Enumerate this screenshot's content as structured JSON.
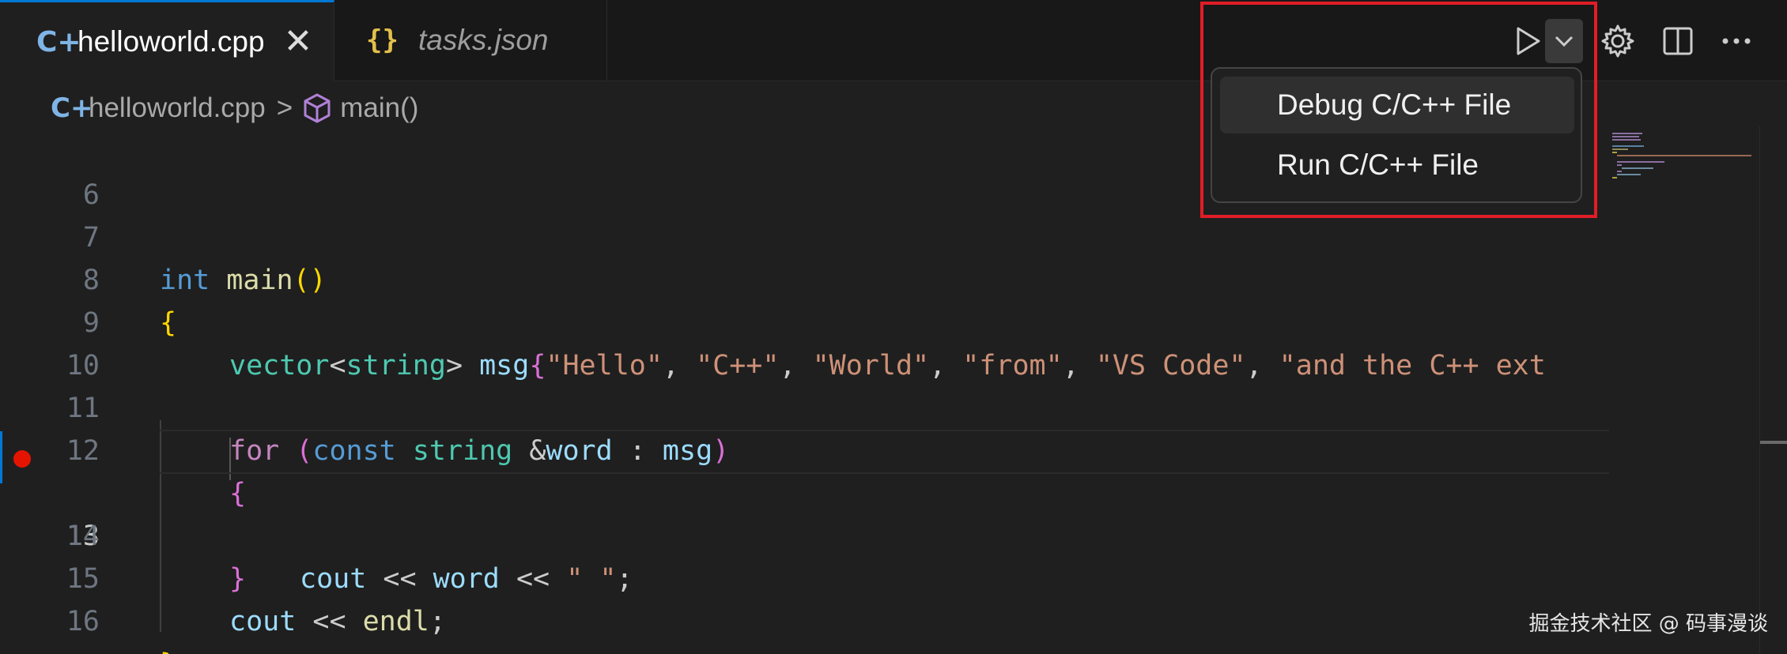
{
  "tabs": [
    {
      "icon": "C+",
      "label": "helloworld.cpp",
      "active": true,
      "close_glyph": "✕"
    },
    {
      "icon": "{}",
      "label": "tasks.json",
      "active": false
    }
  ],
  "breadcrumb": {
    "file_icon": "C+",
    "file": "helloworld.cpp",
    "separator": ">",
    "symbol": "main()"
  },
  "code": {
    "current_line": 13,
    "breakpoint_line": 13,
    "line_numbers": [
      "6",
      "7",
      "8",
      "9",
      "10",
      "11",
      "12",
      "13",
      "14",
      "15",
      "16"
    ],
    "lines": {
      "l7": {
        "kw": "int",
        "fn": "main",
        "paren": "()"
      },
      "l8": {
        "brace": "{"
      },
      "l9": {
        "type1": "vector",
        "lt": "<",
        "type2": "string",
        "gt": ">",
        "var": "msg",
        "brace": "{",
        "s1": "\"Hello\"",
        "c1": ", ",
        "s2": "\"C++\"",
        "c2": ", ",
        "s3": "\"World\"",
        "c3": ", ",
        "s4": "\"from\"",
        "c4": ", ",
        "s5": "\"VS Code\"",
        "c5": ", ",
        "s6": "\"and the C++ ext"
      },
      "l11": {
        "kw_for": "for",
        "open": "(",
        "kw_const": "const",
        "type": "string",
        "amp": "&",
        "var": "word",
        "colon": " : ",
        "msg": "msg",
        "close": ")"
      },
      "l12": {
        "brace": "{"
      },
      "l13": {
        "cout": "cout",
        "op1": " << ",
        "word": "word",
        "op2": " << ",
        "str": "\" \"",
        "semi": ";"
      },
      "l14": {
        "brace": "}"
      },
      "l15": {
        "cout": "cout",
        "op": " << ",
        "endl": "endl",
        "semi": ";"
      },
      "l16": {
        "brace": "}"
      }
    }
  },
  "menu": {
    "items": [
      {
        "label": "Debug C/C++ File",
        "selected": true
      },
      {
        "label": "Run C/C++ File",
        "selected": false
      }
    ]
  },
  "actions": [
    "run-icon",
    "chevron-down-icon",
    "gear-icon",
    "split-editor-icon",
    "more-icon"
  ],
  "colors": {
    "accent": "#0078d4",
    "breakpoint": "#e01d26",
    "annotation_box": "#e01d26"
  },
  "watermark": "掘金技术社区 @ 码事漫谈"
}
